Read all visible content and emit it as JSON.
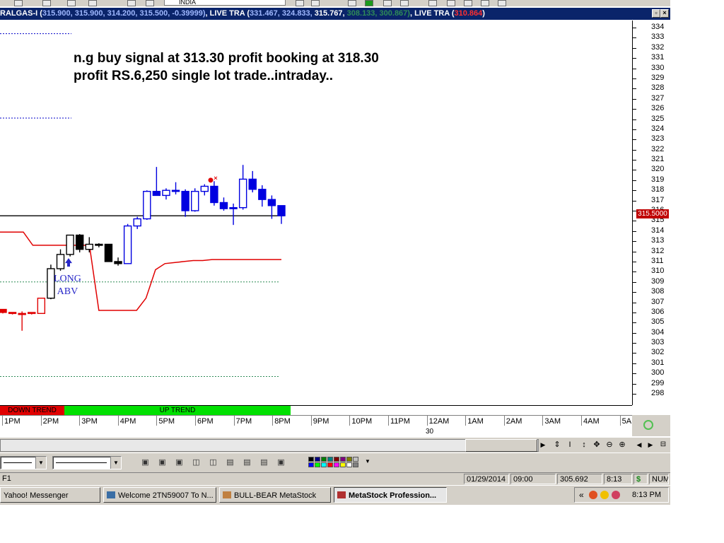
{
  "window": {
    "title_prefix": "RALGAS-I (",
    "title_values_blue": "315.900, 315.900, 314.200, 315.500, -0.39999)",
    "title_live1": ", LIVE TRA (",
    "title_live1_values": "331.467, 324.833, ",
    "title_live1_value_white": "315.767, ",
    "title_live1_values_green": "308.133, 300.867)",
    "title_live2": ", LIVE TRA (",
    "title_live2_value": "310.864",
    "title_live2_close": ")",
    "top_field": "INDIA"
  },
  "annotation": {
    "line1": "n.g buy signal at 313.30 profit booking at 318.30",
    "line2": "profit RS.6,250 single lot trade..intraday.."
  },
  "signal_label": {
    "line1": "LONG",
    "line2": "ABV"
  },
  "price_axis": {
    "ticks": [
      "334",
      "333",
      "332",
      "331",
      "330",
      "329",
      "328",
      "327",
      "326",
      "325",
      "324",
      "323",
      "322",
      "321",
      "320",
      "319",
      "318",
      "317",
      "316",
      "315",
      "314",
      "313",
      "312",
      "311",
      "310",
      "309",
      "308",
      "307",
      "306",
      "305",
      "304",
      "303",
      "302",
      "301",
      "300",
      "299",
      "298"
    ],
    "current_price": "315.5000"
  },
  "trend": {
    "down_label": "DOWN TREND",
    "up_label": "UP TREND"
  },
  "time_axis": {
    "labels": [
      "1PM",
      "2PM",
      "3PM",
      "4PM",
      "5PM",
      "6PM",
      "7PM",
      "8PM",
      "9PM",
      "10PM",
      "11PM",
      "12AM",
      "1AM",
      "2AM",
      "3AM",
      "4AM",
      "5A"
    ],
    "date_label": "30"
  },
  "statusbar": {
    "left": "F1",
    "date": "01/29/2014",
    "time": "09:00",
    "value": "305.692",
    "clock_small": "8:13",
    "dollar": "$",
    "num": "NUM"
  },
  "taskbar": {
    "tasks": [
      {
        "label": "Yahoo! Messenger"
      },
      {
        "label": "Welcome 2TN59007 To N..."
      },
      {
        "label": "BULL-BEAR MetaStock"
      },
      {
        "label": "MetaStock Profession..."
      }
    ],
    "clock": "8:13 PM",
    "chevron": "«"
  },
  "chart_data": {
    "type": "candlestick",
    "price_range": [
      297.4,
      334.9
    ],
    "last_price": 315.5,
    "candles": [
      {
        "o": 306.3,
        "h": 306.3,
        "l": 305.9,
        "c": 306.0,
        "bull": false
      },
      {
        "o": 306.0,
        "h": 306.0,
        "l": 305.8,
        "c": 305.9,
        "bull": false
      },
      {
        "o": 305.9,
        "h": 306.1,
        "l": 304.2,
        "c": 305.9,
        "bull": false
      },
      {
        "o": 305.9,
        "h": 306.0,
        "l": 305.8,
        "c": 306.0,
        "bull": true
      },
      {
        "o": 305.9,
        "h": 307.4,
        "l": 305.9,
        "c": 307.4,
        "bull": true
      },
      {
        "o": 307.4,
        "h": 310.7,
        "l": 307.3,
        "c": 310.3,
        "bull": true
      },
      {
        "o": 310.3,
        "h": 312.2,
        "l": 310.1,
        "c": 311.7,
        "bull": true
      },
      {
        "o": 311.7,
        "h": 313.6,
        "l": 311.5,
        "c": 313.6,
        "bull": true
      },
      {
        "o": 313.6,
        "h": 313.7,
        "l": 311.9,
        "c": 312.2,
        "bull": false
      },
      {
        "o": 312.2,
        "h": 313.4,
        "l": 311.9,
        "c": 312.7,
        "bull": true
      },
      {
        "o": 312.7,
        "h": 312.8,
        "l": 312.4,
        "c": 312.7,
        "bull": false
      },
      {
        "o": 312.7,
        "h": 312.7,
        "l": 311.0,
        "c": 311.0,
        "bull": false
      },
      {
        "o": 311.0,
        "h": 311.4,
        "l": 310.6,
        "c": 310.8,
        "bull": false
      },
      {
        "o": 310.8,
        "h": 314.7,
        "l": 310.8,
        "c": 314.5,
        "bull": true
      },
      {
        "o": 314.5,
        "h": 315.4,
        "l": 314.2,
        "c": 315.2,
        "bull": true
      },
      {
        "o": 315.2,
        "h": 318.0,
        "l": 315.1,
        "c": 317.9,
        "bull": true
      },
      {
        "o": 317.9,
        "h": 320.3,
        "l": 317.6,
        "c": 317.5,
        "bull": false
      },
      {
        "o": 317.5,
        "h": 318.2,
        "l": 317.1,
        "c": 318.0,
        "bull": true
      },
      {
        "o": 318.0,
        "h": 318.8,
        "l": 317.6,
        "c": 317.9,
        "bull": false
      },
      {
        "o": 317.9,
        "h": 318.1,
        "l": 315.4,
        "c": 316.0,
        "bull": false
      },
      {
        "o": 316.0,
        "h": 318.2,
        "l": 315.9,
        "c": 317.9,
        "bull": true
      },
      {
        "o": 317.9,
        "h": 318.6,
        "l": 317.5,
        "c": 318.4,
        "bull": true
      },
      {
        "o": 318.4,
        "h": 318.9,
        "l": 316.5,
        "c": 316.8,
        "bull": false
      },
      {
        "o": 316.8,
        "h": 317.3,
        "l": 316.0,
        "c": 316.2,
        "bull": false
      },
      {
        "o": 316.2,
        "h": 316.7,
        "l": 314.6,
        "c": 316.3,
        "bull": false
      },
      {
        "o": 316.3,
        "h": 320.5,
        "l": 316.1,
        "c": 319.1,
        "bull": true
      },
      {
        "o": 319.1,
        "h": 319.9,
        "l": 317.8,
        "c": 318.1,
        "bull": false
      },
      {
        "o": 318.1,
        "h": 318.5,
        "l": 316.4,
        "c": 317.1,
        "bull": false
      },
      {
        "o": 317.1,
        "h": 317.5,
        "l": 315.2,
        "c": 316.5,
        "bull": false
      },
      {
        "o": 316.5,
        "h": 316.5,
        "l": 314.7,
        "c": 315.5,
        "bull": false
      }
    ],
    "stop_line": [
      313.9,
      313.9,
      312.6,
      312.6,
      312.6,
      312.6,
      312.6,
      312.6,
      312.6,
      306.2,
      306.2,
      306.2,
      306.2,
      306.2,
      307.4,
      310.2,
      310.8,
      310.9,
      311.0,
      311.1,
      311.1,
      311.2,
      311.2,
      311.2,
      311.2,
      311.2,
      311.2,
      311.2,
      311.2,
      311.2,
      311.2
    ],
    "horizontal_lines": [
      {
        "price": 315.5,
        "style": "solid",
        "color": "#000000"
      },
      {
        "price": 309.0,
        "style": "dotted",
        "color": "#2e8b57"
      },
      {
        "price": 299.7,
        "style": "dotted",
        "color": "#2e8b57"
      },
      {
        "price": 333.4,
        "style": "dotted",
        "color": "#0000c8"
      },
      {
        "price": 325.1,
        "style": "dotted",
        "color": "#0000c8"
      }
    ],
    "sell_marker_price": 319.0
  },
  "colors": {
    "title_bg": "#0a246a",
    "bull_candle": "#0000e0",
    "bear_candle": "#000000",
    "stop_line": "#e00000",
    "down_trend": "#e00000",
    "up_trend": "#00e000",
    "price_box": "#c00000"
  }
}
